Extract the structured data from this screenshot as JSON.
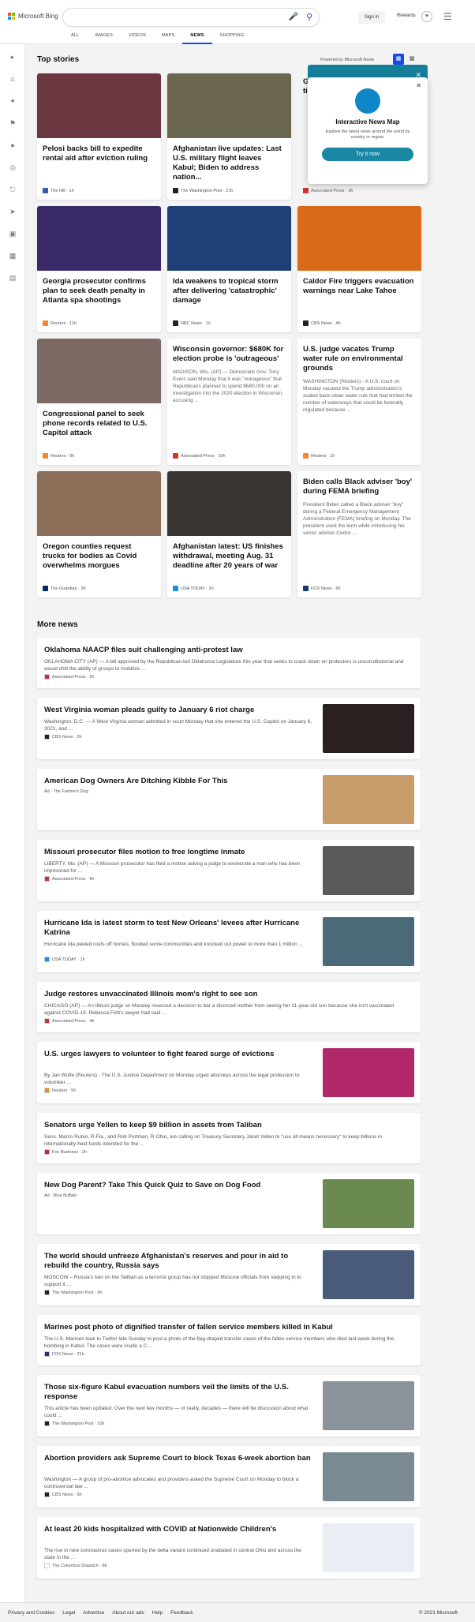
{
  "header": {
    "brand": "Microsoft Bing",
    "signin": "Sign in",
    "rewards": "Rewards",
    "tabs": [
      "ALL",
      "IMAGES",
      "VIDEOS",
      "MAPS",
      "NEWS",
      "SHOPPING"
    ]
  },
  "top_stories": {
    "heading": "Top stories",
    "powered": "Powered by Microsoft News"
  },
  "popup": {
    "title": "Interactive News Map",
    "subtitle": "Explore the latest news around the world by country or region.",
    "button": "Try it now"
  },
  "peek": {
    "title": "G... ti...",
    "snip": "LA...\nW...\nM...\na mana...\nenact t...",
    "source": "Associated Press · 3h"
  },
  "cards": [
    {
      "title": "Pelosi backs bill to expedite rental aid after eviction ruling",
      "snip": "",
      "source": "The Hill · 1h",
      "color": "#3b5ab0",
      "img": "#6a3640"
    },
    {
      "title": "Afghanistan live updates: Last U.S. military flight leaves Kabul; Biden to address nation...",
      "snip": "",
      "source": "The Washington Post · 21h",
      "color": "#222",
      "img": "#6b6650"
    },
    {
      "title": "Georgia prosecutor confirms plan to seek death penalty in Atlanta spa shootings",
      "snip": "",
      "source": "Reuters · 11h",
      "color": "#f08a2c",
      "img": "#3a2a6a"
    },
    {
      "title": "Ida weakens to tropical storm after delivering 'catastrophic' damage",
      "snip": "",
      "source": "NBC News · 1h",
      "color": "#222",
      "img": "#1f3f78"
    },
    {
      "title": "Caldor Fire triggers evacuation warnings near Lake Tahoe",
      "snip": "",
      "source": "CBS News · 4h",
      "color": "#222",
      "img": "#d96a18"
    },
    {
      "title": "Congressional panel to seek phone records related to U.S. Capitol attack",
      "snip": "",
      "source": "Reuters · 9h",
      "color": "#f08a2c",
      "img": "#7a6a63"
    },
    {
      "title": "Wisconsin governor: $680K for election probe is 'outrageous'",
      "snip": "MADISON, Wis. (AP) — Democratic Gov. Tony Evers said Monday that it was \"outrageous\" that Republicans planned to spend $680,000 on an investigation into the 2020 election in Wisconsin, accusing ...",
      "source": "Associated Press · 10h",
      "color": "#c33",
      "img": ""
    },
    {
      "title": "U.S. judge vacates Trump water rule on environmental grounds",
      "snip": "WASHINGTON (Reuters) - A U.S. court on Monday vacated the Trump administration's scaled back clean water rule that had limited the number of waterways that could be federally regulated because ...",
      "source": "Reuters · 1h",
      "color": "#f08a2c",
      "img": ""
    },
    {
      "title": "Oregon counties request trucks for bodies as Covid overwhelms morgues",
      "snip": "",
      "source": "The Guardian · 3h",
      "color": "#052962",
      "img": "#8a6e58"
    },
    {
      "title": "Afghanistan latest: US finishes withdrawal, meeting Aug. 31 deadline after 20 years of war",
      "snip": "",
      "source": "USA TODAY · 2h",
      "color": "#1a8fe0",
      "img": "#3a3530"
    },
    {
      "title": "Biden calls Black adviser 'boy' during FEMA briefing",
      "snip": "President Biden called a Black adviser \"boy\" during a Federal Emergency Management Administration (FEMA) briefing on Monday. The president used the term while introducing his senior adviser Cedric ...",
      "source": "FOX News · 6h",
      "color": "#1a3a6e",
      "img": ""
    }
  ],
  "more_news": {
    "heading": "More news",
    "items": [
      {
        "title": "Oklahoma NAACP files suit challenging anti-protest law",
        "snip": "OKLAHOMA CITY (AP) — A bill approved by the Republican-led Oklahoma Legislature this year that seeks to crack down on protesters is unconstitutional and would chill the ability of groups to mobilize ...",
        "source": "Associated Press · 2h",
        "color": "#c33",
        "thumb": ""
      },
      {
        "title": "West Virginia woman pleads guilty to January 6 riot charge",
        "snip": "Washington, D.C. — A West Virginia woman admitted in court Monday that she entered the U.S. Capitol on January 6, 2021, and ...",
        "source": "CBS News · 2h",
        "color": "#222",
        "thumb": "#2b2020"
      },
      {
        "title": "American Dog Owners Are Ditching Kibble For This",
        "snip": "",
        "source": "Ad · The Farmer's Dog",
        "color": "",
        "thumb": "#c79d6a"
      },
      {
        "title": "Missouri prosecutor files motion to free longtime inmate",
        "snip": "LIBERTY, Mo. (AP) — A Missouri prosecutor has filed a motion asking a judge to exonerate a man who has been imprisoned for ...",
        "source": "Associated Press · 9h",
        "color": "#c33",
        "thumb": "#5a5a5a"
      },
      {
        "title": "Hurricane Ida is latest storm to test New Orleans' levees after Hurricane Katrina",
        "snip": "Hurricane Ida peeled roofs off homes, flooded some communities and knocked out power to more than 1 million ...",
        "source": "USA TODAY · 1h",
        "color": "#1a8fe0",
        "thumb": "#4a6a7a"
      },
      {
        "title": "Judge restores unvaccinated Illinois mom's right to see son",
        "snip": "CHICAGO (AP) — An Illinois judge on Monday reversed a decision to bar a divorced mother from seeing her 11-year-old son because she isn't vaccinated against COVID-19. Rebecca Firlit's lawyer had said ...",
        "source": "Associated Press · 4h",
        "color": "#c33",
        "thumb": ""
      },
      {
        "title": "U.S. urges lawyers to volunteer to fight feared surge of evictions",
        "snip": "By Jan Wolfe (Reuters) - The U.S. Justice Department on Monday urged attorneys across the legal profession to volunteer ...",
        "source": "Reuters · 5h",
        "color": "#f08a2c",
        "thumb": "#b0286a"
      },
      {
        "title": "Senators urge Yellen to keep $9 billion in assets from Taliban",
        "snip": "Sens. Marco Rubio, R-Fla., and Rob Portman, R-Ohio, are calling on Treasury Secretary Janet Yellen to \"use all means necessary\" to keep billions in internationally-held funds intended for the ...",
        "source": "Fox Business · 2h",
        "color": "#c22",
        "thumb": ""
      },
      {
        "title": "New Dog Parent? Take This Quick Quiz to Save on Dog Food",
        "snip": "",
        "source": "Ad · Blue Buffalo",
        "color": "",
        "thumb": "#6b8a52"
      },
      {
        "title": "The world should unfreeze Afghanistan's reserves and pour in aid to rebuild the country, Russia says",
        "snip": "MOSCOW – Russia's ban on the Taliban as a terrorist group has not stopped Moscow officials from stepping in to support it ...",
        "source": "The Washington Post · 9h",
        "color": "#222",
        "thumb": "#4a5a7a"
      },
      {
        "title": "Marines post photo of dignified transfer of fallen service members killed in Kabul",
        "snip": "The U.S. Marines took to Twitter late Sunday to post a photo of the flag-draped transfer cases of the fallen service members who died last week during the bombing in Kabul. The cases were inside a C ...",
        "source": "FOX News · 21h",
        "color": "#1a3a6e",
        "thumb": ""
      },
      {
        "title": "Those six-figure Kabul evacuation numbers veil the limits of the U.S. response",
        "snip": "This article has been updated. Over the next few months — or really, decades — there will be discussion about what could ...",
        "source": "The Washington Post · 10h",
        "color": "#222",
        "thumb": "#8a929a"
      },
      {
        "title": "Abortion providers ask Supreme Court to block Texas 6-week abortion ban",
        "snip": "Washington — A group of pro-abortion advocates and providers asked the Supreme Court on Monday to block a controversial law ...",
        "source": "CBS News · 5h",
        "color": "#222",
        "thumb": "#7a8a95"
      },
      {
        "title": "At least 20 kids hospitalized with COVID at Nationwide Children's",
        "snip": "The rise in new coronavirus cases spurred by the delta variant continued unabated in central Ohio and across the state in the ...",
        "source": "The Columbus Dispatch · 8h",
        "color": "#fff",
        "thumb": "#e8eef4"
      }
    ]
  },
  "footer": {
    "links": [
      "Privacy and Cookies",
      "Legal",
      "Advertise",
      "About our ads",
      "Help",
      "Feedback"
    ],
    "copyright": "© 2021 Microsoft"
  }
}
